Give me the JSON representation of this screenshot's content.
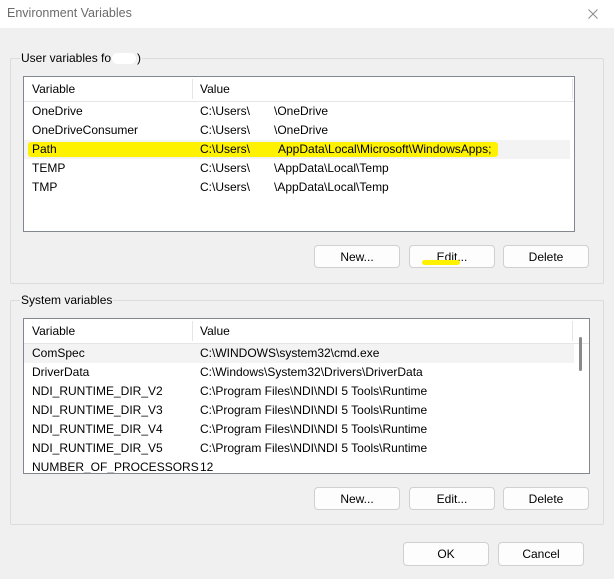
{
  "window": {
    "title": "Environment Variables",
    "close_icon": "close-icon"
  },
  "user_vars": {
    "label_prefix": "User variables fo",
    "label_suffix": ")",
    "headers": {
      "variable": "Variable",
      "value": "Value"
    },
    "rows": [
      {
        "variable": "OneDrive",
        "value_a": "C:\\Users\\",
        "value_b": "\\OneDrive"
      },
      {
        "variable": "OneDriveConsumer",
        "value_a": "C:\\Users\\",
        "value_b": "\\OneDrive"
      },
      {
        "variable": "Path",
        "value_a": "C:\\Users\\",
        "value_b": "AppData\\Local\\Microsoft\\WindowsApps;"
      },
      {
        "variable": "TEMP",
        "value_a": "C:\\Users\\",
        "value_b": "\\AppData\\Local\\Temp"
      },
      {
        "variable": "TMP",
        "value_a": "C:\\Users\\",
        "value_b": "\\AppData\\Local\\Temp"
      }
    ],
    "buttons": {
      "new": "New...",
      "edit": "Edit...",
      "delete": "Delete"
    }
  },
  "system_vars": {
    "label": "System variables",
    "headers": {
      "variable": "Variable",
      "value": "Value"
    },
    "rows": [
      {
        "variable": "ComSpec",
        "value": "C:\\WINDOWS\\system32\\cmd.exe"
      },
      {
        "variable": "DriverData",
        "value": "C:\\Windows\\System32\\Drivers\\DriverData"
      },
      {
        "variable": "NDI_RUNTIME_DIR_V2",
        "value": "C:\\Program Files\\NDI\\NDI 5 Tools\\Runtime"
      },
      {
        "variable": "NDI_RUNTIME_DIR_V3",
        "value": "C:\\Program Files\\NDI\\NDI 5 Tools\\Runtime"
      },
      {
        "variable": "NDI_RUNTIME_DIR_V4",
        "value": "C:\\Program Files\\NDI\\NDI 5 Tools\\Runtime"
      },
      {
        "variable": "NDI_RUNTIME_DIR_V5",
        "value": "C:\\Program Files\\NDI\\NDI 5 Tools\\Runtime"
      },
      {
        "variable": "NUMBER_OF_PROCESSORS",
        "value": "12"
      }
    ],
    "buttons": {
      "new": "New...",
      "edit": "Edit...",
      "delete": "Delete"
    }
  },
  "footer": {
    "ok": "OK",
    "cancel": "Cancel"
  },
  "colors": {
    "highlight": "#fff200",
    "selected_row": "#f3f3f3"
  }
}
